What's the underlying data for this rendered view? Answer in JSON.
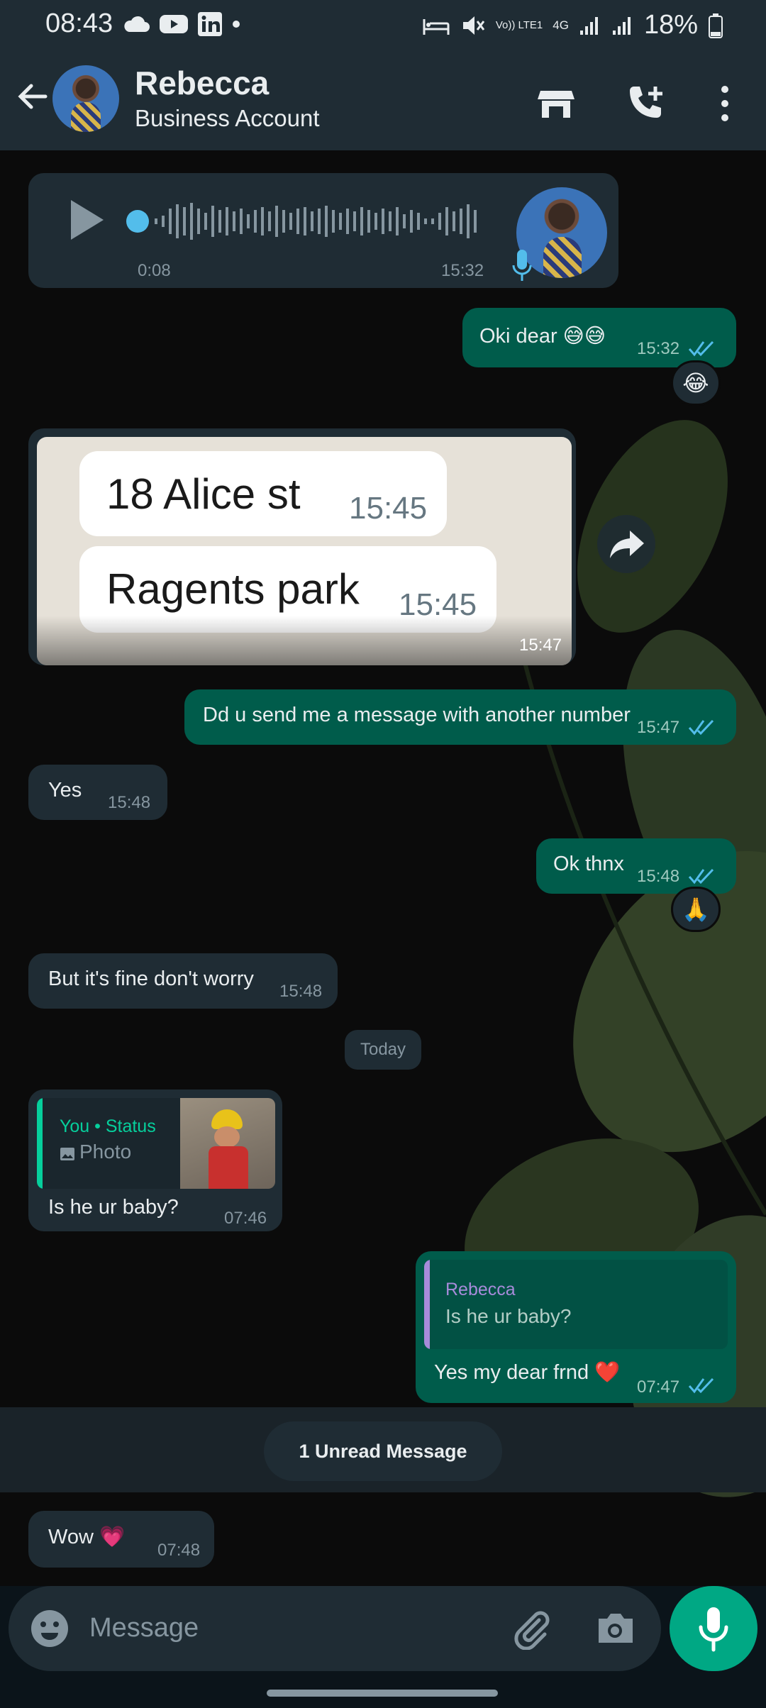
{
  "status_bar": {
    "time": "08:43",
    "battery": "18%",
    "network_a": "Vo)) LTE1",
    "network_b": "4G",
    "icons_left": [
      "cloud-icon",
      "youtube-icon",
      "linkedin-icon",
      "dot-icon"
    ],
    "icons_right": [
      "sleep-icon",
      "mute-icon",
      "signal-icon",
      "battery-icon"
    ]
  },
  "header": {
    "contact_name": "Rebecca",
    "subtitle": "Business Account"
  },
  "messages": {
    "voice": {
      "duration": "0:08",
      "time": "15:32"
    },
    "m1": {
      "text": "Oki dear 😅😅",
      "time": "15:32",
      "reaction": "😂"
    },
    "image": {
      "time": "15:47",
      "screenshot_line1": "18 Alice st",
      "screenshot_time1": "15:45",
      "screenshot_line2": "Ragents park",
      "screenshot_time2": "15:45"
    },
    "m2": {
      "text": "Dd u send me a message with another number",
      "time": "15:47"
    },
    "m3": {
      "text": "Yes",
      "time": "15:48"
    },
    "m4": {
      "text": "Ok thnx",
      "time": "15:48",
      "reaction": "🙏"
    },
    "m5": {
      "text": "But it's fine don't worry",
      "time": "15:48"
    },
    "date_chip": "Today",
    "m6": {
      "quote_author": "You • Status",
      "quote_type": "Photo",
      "text": "Is he ur baby?",
      "time": "07:46"
    },
    "m7": {
      "quote_author": "Rebecca",
      "quote_text": "Is he ur baby?",
      "text": "Yes my dear frnd ❤️",
      "time": "07:47"
    },
    "unread": "1 Unread Message",
    "m8": {
      "text": "Wow 💗",
      "time": "07:48"
    }
  },
  "composer": {
    "placeholder": "Message"
  },
  "colors": {
    "accent": "#00a884",
    "outgoing": "#005c4b",
    "incoming": "#1f2c34",
    "ticks": "#53bdeb"
  }
}
